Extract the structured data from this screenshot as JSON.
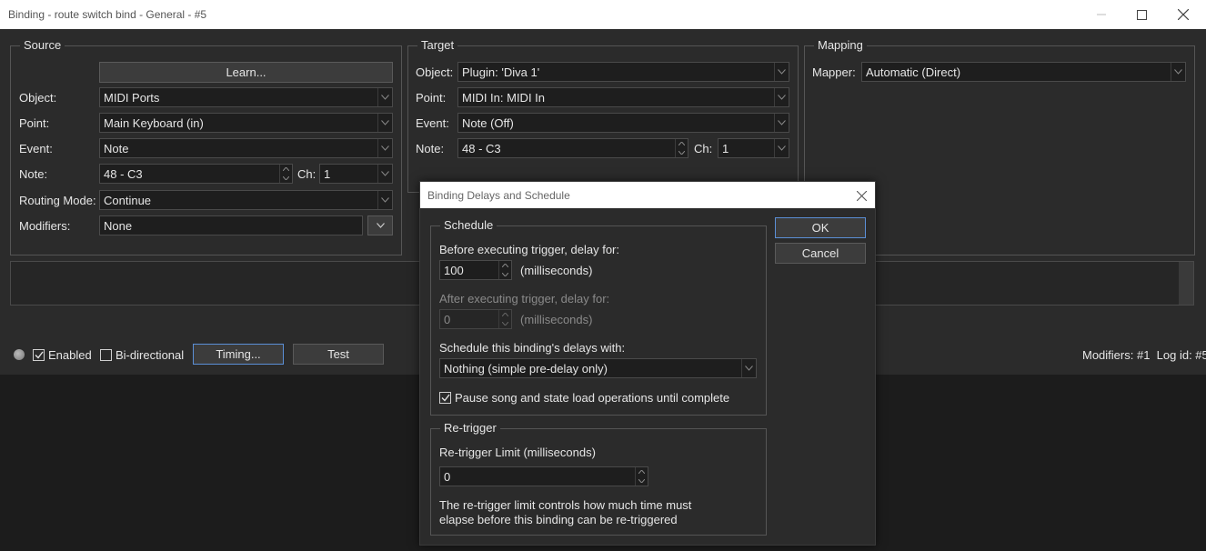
{
  "window": {
    "title": "Binding - route switch bind - General - #5",
    "controls": [
      "minimize-icon",
      "maximize-icon",
      "close-icon"
    ]
  },
  "source": {
    "group_title": "Source",
    "learn_button": "Learn...",
    "object_label": "Object:",
    "object_value": "MIDI Ports",
    "point_label": "Point:",
    "point_value": "Main Keyboard (in)",
    "event_label": "Event:",
    "event_value": "Note",
    "note_label": "Note:",
    "note_value": "48 - C3",
    "ch_label": "Ch:",
    "ch_value": "1",
    "routing_label": "Routing Mode:",
    "routing_value": "Continue",
    "modifiers_label": "Modifiers:",
    "modifiers_value": "None"
  },
  "target": {
    "group_title": "Target",
    "object_label": "Object:",
    "object_value": "Plugin: 'Diva 1'",
    "point_label": "Point:",
    "point_value": "MIDI In: MIDI In",
    "event_label": "Event:",
    "event_value": "Note (Off)",
    "note_label": "Note:",
    "note_value": "48 - C3",
    "ch_label": "Ch:",
    "ch_value": "1"
  },
  "mapping": {
    "group_title": "Mapping",
    "mapper_label": "Mapper:",
    "mapper_value": "Automatic (Direct)"
  },
  "bottom": {
    "enabled_label": "Enabled",
    "enabled_checked": true,
    "bidirectional_label": "Bi-directional",
    "bidirectional_checked": false,
    "timing_button": "Timing...",
    "test_button": "Test",
    "status_text": "Modifiers: #1  Log id: #5"
  },
  "dialog": {
    "title": "Binding Delays and Schedule",
    "ok_button": "OK",
    "cancel_button": "Cancel",
    "schedule": {
      "group_title": "Schedule",
      "before_label": "Before executing trigger, delay for:",
      "before_value": "100",
      "before_unit": "(milliseconds)",
      "after_label": "After executing trigger, delay for:",
      "after_value": "0",
      "after_unit": "(milliseconds)",
      "schedule_with_label": "Schedule this binding's delays with:",
      "schedule_with_value": "Nothing (simple pre-delay only)",
      "pause_label": "Pause song and state load operations until complete",
      "pause_checked": true
    },
    "retrigger": {
      "group_title": "Re-trigger",
      "limit_label": "Re-trigger Limit (milliseconds)",
      "limit_value": "0",
      "description_line1": "The re-trigger limit controls how much time must",
      "description_line2": "elapse before this binding can be re-triggered"
    }
  },
  "colors": {
    "background": "#2b2b2b",
    "titlebar": "#ffffff",
    "field_bg": "#1e1e1e",
    "focus_border": "#5b8fd6"
  }
}
